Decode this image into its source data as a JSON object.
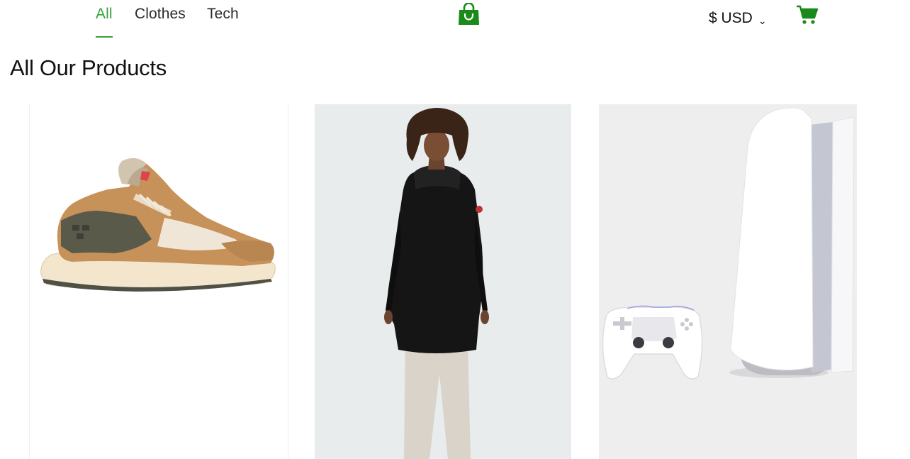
{
  "nav": {
    "tabs": [
      {
        "label": "All",
        "active": true
      },
      {
        "label": "Clothes",
        "active": false
      },
      {
        "label": "Tech",
        "active": false
      }
    ]
  },
  "header": {
    "logo_icon": "shopping-bag-icon",
    "currency": {
      "symbol": "$",
      "code": "USD",
      "label": "$ USD"
    },
    "cart_icon": "cart-icon",
    "accent_color": "#3aa03a",
    "brand_green": "#1a8a1a"
  },
  "page": {
    "title": "All Our Products"
  },
  "products": [
    {
      "image": "sneaker"
    },
    {
      "image": "black-parka-model"
    },
    {
      "image": "game-console-and-controller"
    }
  ]
}
